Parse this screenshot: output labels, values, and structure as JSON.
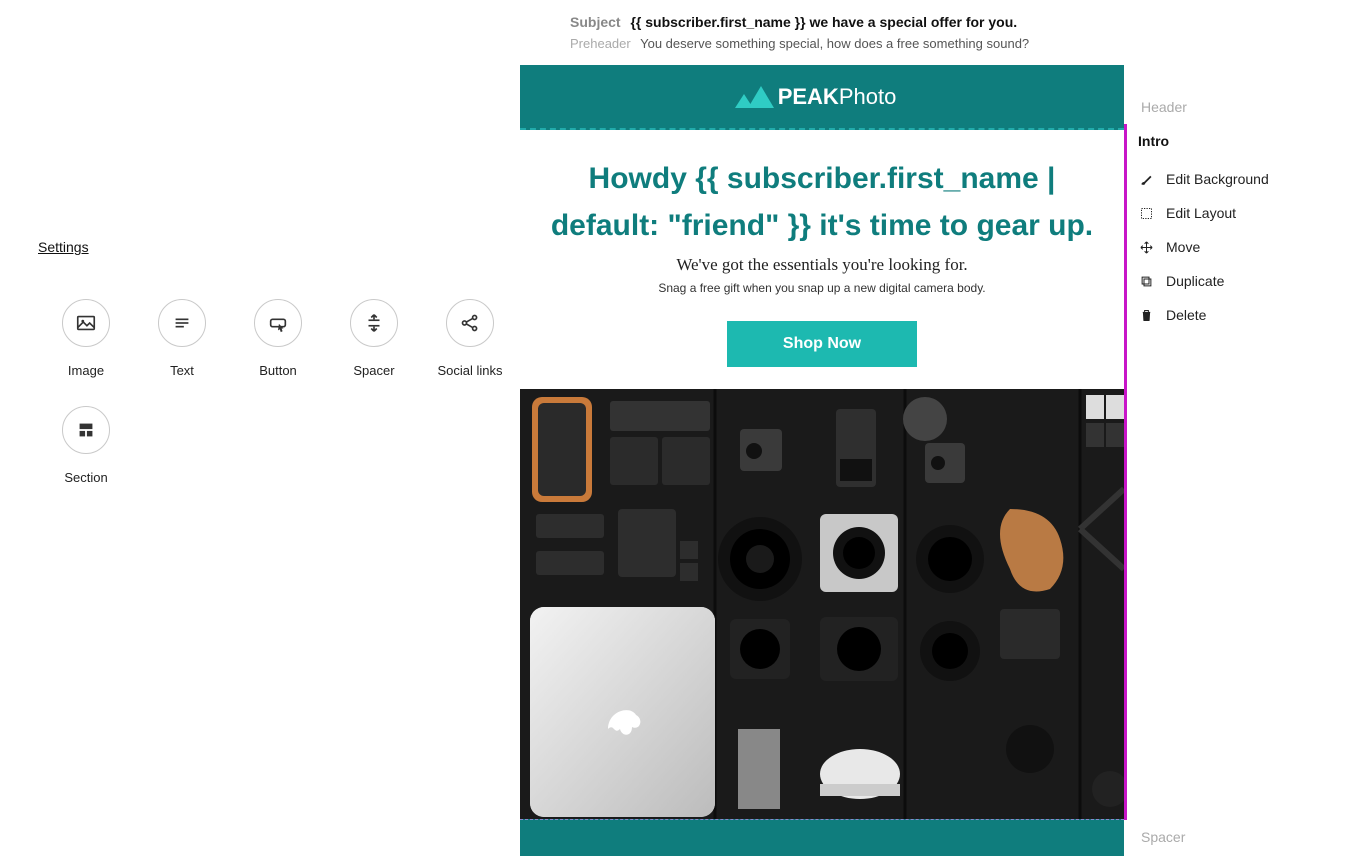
{
  "left": {
    "settings": "Settings",
    "items": [
      {
        "label": "Image"
      },
      {
        "label": "Text"
      },
      {
        "label": "Button"
      },
      {
        "label": "Spacer"
      },
      {
        "label": "Social links"
      },
      {
        "label": "Section"
      }
    ]
  },
  "email": {
    "subject_label": "Subject",
    "subject_value": "{{ subscriber.first_name }} we have a special offer for you.",
    "preheader_label": "Preheader",
    "preheader_value": "You deserve something special, how does a free something sound?",
    "brand_bold": "PEAK",
    "brand_light": "Photo",
    "headline": "Howdy {{ subscriber.first_name | default: \"friend\" }} it's time to gear up.",
    "subline": "We've got the essentials you're looking for.",
    "small": "Snag a free gift when you snap up a new digital camera body.",
    "cta": "Shop Now"
  },
  "right": {
    "sections": {
      "header": "Header",
      "intro": "Intro",
      "spacer": "Spacer"
    },
    "actions": {
      "edit_bg": "Edit Background",
      "edit_layout": "Edit Layout",
      "move": "Move",
      "duplicate": "Duplicate",
      "delete": "Delete"
    }
  }
}
